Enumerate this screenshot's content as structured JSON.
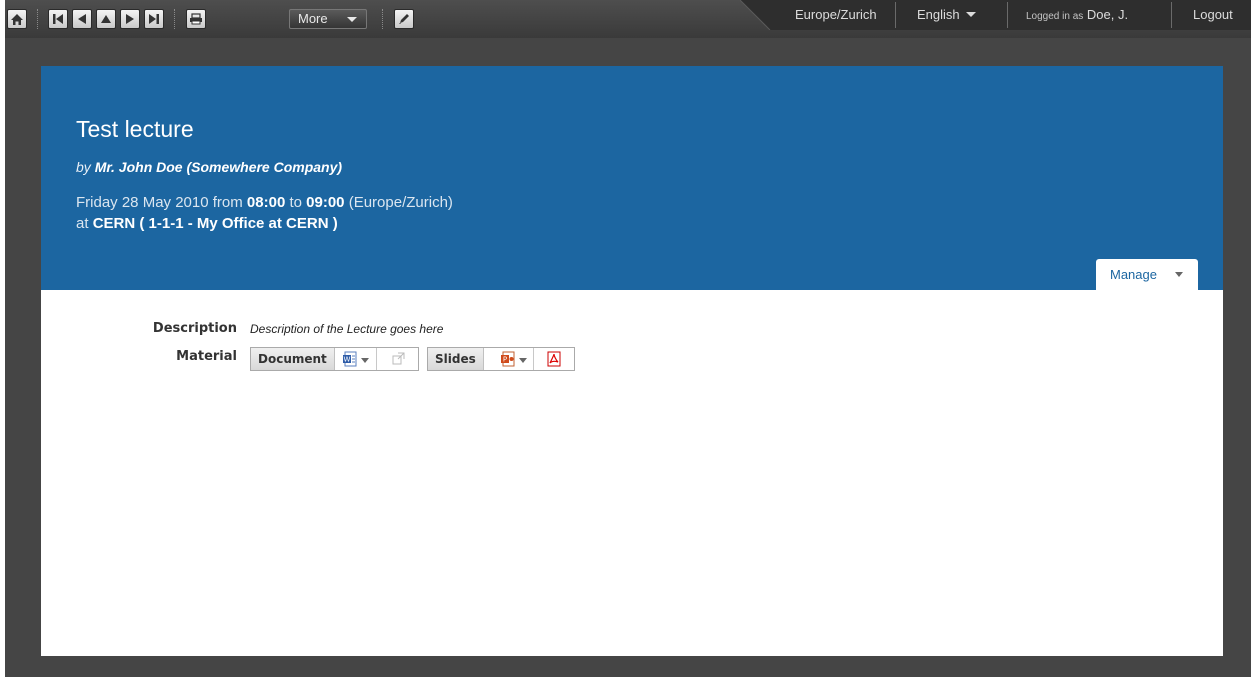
{
  "topbar": {
    "buttons": [
      {
        "name": "home-icon"
      },
      {
        "name": "first-icon"
      },
      {
        "name": "previous-icon"
      },
      {
        "name": "up-icon"
      },
      {
        "name": "next-icon"
      },
      {
        "name": "last-icon"
      },
      {
        "name": "print-icon"
      },
      {
        "name": "edit-icon"
      }
    ],
    "more_label": "More",
    "timezone": "Europe/Zurich",
    "language": "English",
    "logged_in_prefix": "Logged in as",
    "user": "Doe, J.",
    "logout": "Logout"
  },
  "event": {
    "title": "Test lecture",
    "by_prefix": "by",
    "speaker": "Mr. John Doe (Somewhere Company)",
    "date_prefix": "Friday 28 May 2010 from",
    "start": "08:00",
    "to": "to",
    "end": "09:00",
    "timezone_note": "(Europe/Zurich)",
    "at_prefix": "at",
    "location": "CERN ( 1-1-1 - My Office at CERN )",
    "manage_label": "Manage"
  },
  "details": {
    "description_label": "Description",
    "description_value": "Description of the Lecture goes here",
    "material_label": "Material",
    "materials": [
      {
        "label": "Document",
        "icons": [
          "word-doc-icon",
          "external-link-icon"
        ]
      },
      {
        "label": "Slides",
        "icons": [
          "powerpoint-icon",
          "pdf-icon"
        ]
      }
    ]
  },
  "colors": {
    "header_blue": "#1c66a1",
    "frame_dark": "#454545"
  }
}
